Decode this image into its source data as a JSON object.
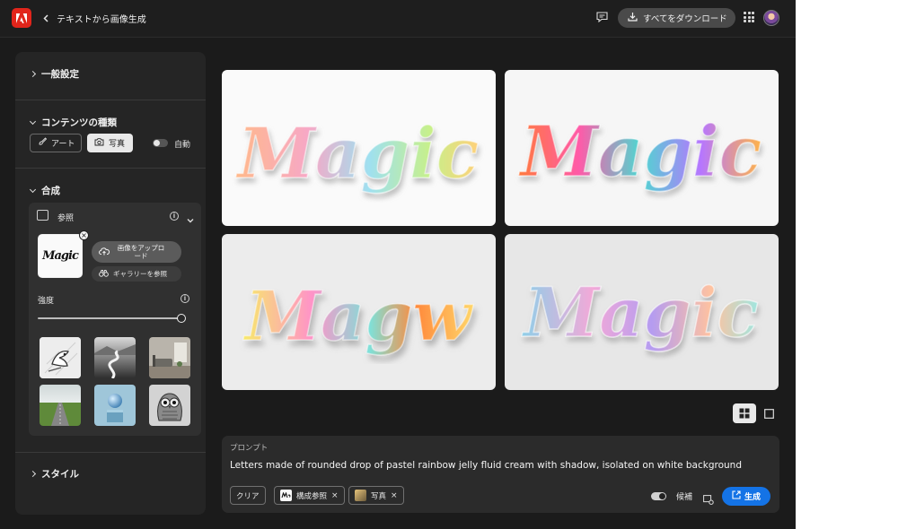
{
  "header": {
    "title": "テキストから画像生成",
    "download_all": "すべてをダウンロード"
  },
  "sidebar": {
    "general_settings": "一般設定",
    "content_type": {
      "heading": "コンテンツの種類",
      "art_label": "アート",
      "photo_label": "写真",
      "auto_label": "自動",
      "selected": "写真"
    },
    "composition": {
      "heading": "合成",
      "reference": {
        "title": "参照",
        "thumb_text": "Magic",
        "upload_label": "画像をアップロード",
        "gallery_label": "ギャラリーを参照"
      },
      "strength_label": "強度",
      "strength_value": 1.0,
      "presets": [
        "bird-sketch",
        "winding-river",
        "living-room",
        "green-road",
        "blue-sphere",
        "owl-illustration"
      ]
    },
    "style": "スタイル"
  },
  "main": {
    "images": [
      {
        "name": "result-image-1",
        "text": "Magic"
      },
      {
        "name": "result-image-2",
        "text": "Magic"
      },
      {
        "name": "result-image-3",
        "text": "Magw"
      },
      {
        "name": "result-image-4",
        "text": "Magic"
      }
    ],
    "layout_mode": "grid"
  },
  "prompt": {
    "label": "プロンプト",
    "text": "Letters made of rounded drop of pastel rainbow jelly fluid cream with shadow, isolated on white background",
    "clear_label": "クリア",
    "chips": [
      {
        "label": "構成参照"
      },
      {
        "label": "写真"
      }
    ],
    "candidates_label": "候補",
    "generate_label": "生成"
  },
  "colors": {
    "accent": "#1473e6",
    "adobe_red": "#e1251b",
    "background": "#1b1b1b",
    "panel": "#252525"
  }
}
